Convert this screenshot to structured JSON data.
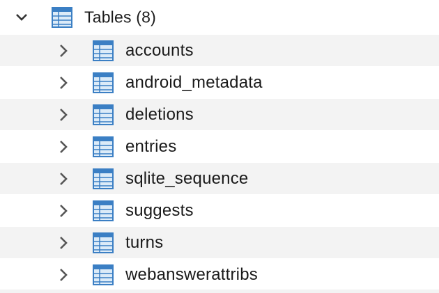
{
  "tree": {
    "root": {
      "label": "Tables (8)",
      "expanded": true,
      "icon": "table-icon"
    },
    "items": [
      {
        "label": "accounts",
        "icon": "table-icon",
        "expanded": false
      },
      {
        "label": "android_metadata",
        "icon": "table-icon",
        "expanded": false
      },
      {
        "label": "deletions",
        "icon": "table-icon",
        "expanded": false
      },
      {
        "label": "entries",
        "icon": "table-icon",
        "expanded": false
      },
      {
        "label": "sqlite_sequence",
        "icon": "table-icon",
        "expanded": false
      },
      {
        "label": "suggests",
        "icon": "table-icon",
        "expanded": false
      },
      {
        "label": "turns",
        "icon": "table-icon",
        "expanded": false
      },
      {
        "label": "webanswerattribs",
        "icon": "table-icon",
        "expanded": false
      }
    ]
  },
  "colors": {
    "icon_blue": "#3b7fc4",
    "icon_fill": "#dcebf8",
    "chevron": "#555555",
    "row_alt": "#f3f3f3",
    "text": "#1a1a1a"
  }
}
